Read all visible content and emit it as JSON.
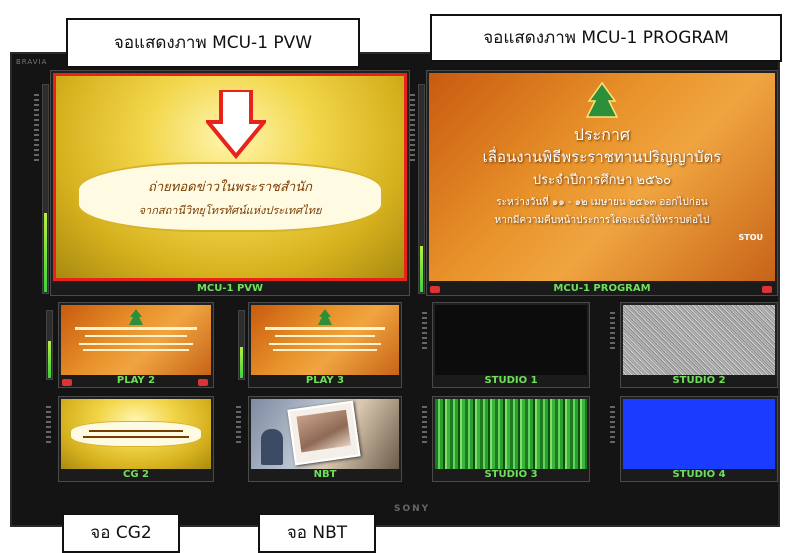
{
  "annotations": {
    "pvw": "จอแสดงภาพ MCU-1 PVW",
    "program": "จอแสดงภาพ MCU-1 PROGRAM",
    "cg2": "จอ CG2",
    "nbt": "จอ NBT"
  },
  "monitor": {
    "brand_top_left": "BRAVIA",
    "brand_bottom": "SONY"
  },
  "tiles": {
    "pvw": {
      "label": "MCU-1 PVW"
    },
    "program": {
      "label": "MCU-1 PROGRAM"
    },
    "play2": {
      "label": "PLAY 2"
    },
    "play3": {
      "label": "PLAY 3"
    },
    "studio1": {
      "label": "STUDIO 1"
    },
    "studio2": {
      "label": "STUDIO 2"
    },
    "cg2": {
      "label": "CG 2"
    },
    "nbt": {
      "label": "NBT"
    },
    "studio3": {
      "label": "STUDIO 3"
    },
    "studio4": {
      "label": "STUDIO 4"
    }
  },
  "program_content": {
    "heading": "ประกาศ",
    "line1": "เลื่อนงานพิธีพระราชทานปริญญาบัตร",
    "line2": "ประจำปีการศึกษา ๒๕๖๐",
    "line3": "ระหว่างวันที่ ๑๑ - ๑๒ เมษายน ๒๕๖๓ ออกไปก่อน",
    "line4": "หากมีความคืบหน้าประการใดจะแจ้งให้ทราบต่อไป",
    "logo_text": "STOU"
  },
  "pvw_content": {
    "line1": "ถ่ายทอดข่าวในพระราชสำนัก",
    "line2": "จากสถานีวิทยุโทรทัศน์แห่งประเทศไทย"
  },
  "colors": {
    "tally_label": "#6fe05a",
    "pvw_border": "#e8231a",
    "arrow": "#e8231a",
    "studio4_blue": "#1a3cff"
  }
}
